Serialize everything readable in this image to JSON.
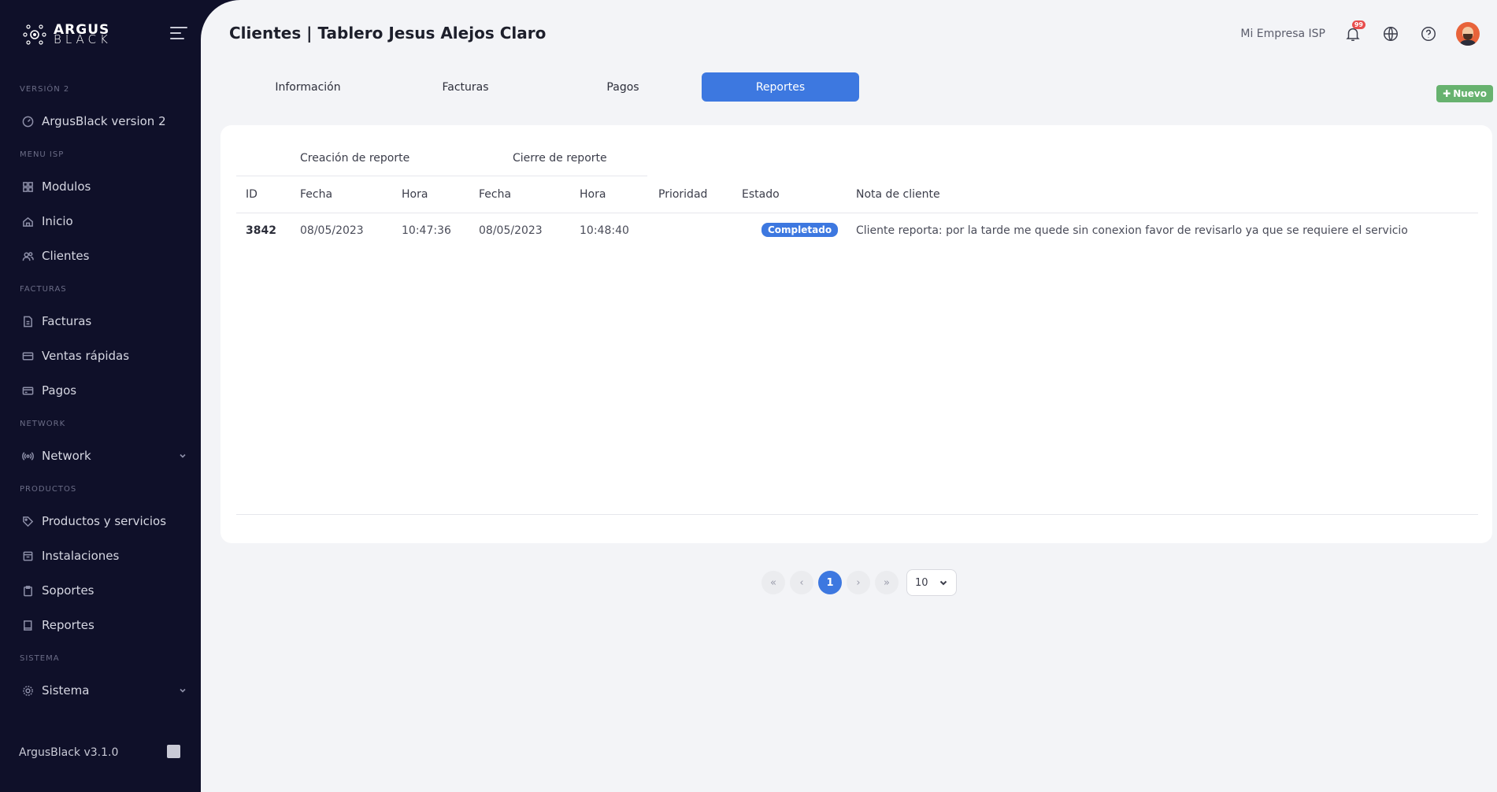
{
  "sidebar": {
    "logo_top": "ARGUS",
    "logo_bottom": "BLACK",
    "sections": {
      "version": "VERSIÓN 2",
      "menu_isp": "MENU ISP",
      "facturas": "FACTURAS",
      "network": "NETWORK",
      "productos": "PRODUCTOS",
      "sistema": "SISTEMA"
    },
    "items": {
      "argus_v2": "ArgusBlack version 2",
      "modulos": "Modulos",
      "inicio": "Inicio",
      "clientes": "Clientes",
      "facturas": "Facturas",
      "ventas": "Ventas rápidas",
      "pagos": "Pagos",
      "network": "Network",
      "productos": "Productos y servicios",
      "instalaciones": "Instalaciones",
      "soportes": "Soportes",
      "reportes": "Reportes",
      "sistema": "Sistema"
    },
    "footer_version": "ArgusBlack v3.1.0"
  },
  "header": {
    "title": "Clientes | Tablero Jesus Alejos Claro",
    "company": "Mi Empresa ISP",
    "notification_count": "99"
  },
  "tabs": [
    "Información",
    "Facturas",
    "Pagos",
    "Reportes"
  ],
  "new_button": "Nuevo",
  "table": {
    "group_creation": "Creación de reporte",
    "group_close": "Cierre de reporte",
    "columns": [
      "ID",
      "Fecha",
      "Hora",
      "Fecha",
      "Hora",
      "Prioridad",
      "Estado",
      "Nota de cliente"
    ],
    "rows": [
      {
        "id": "3842",
        "created_date": "08/05/2023",
        "created_time": "10:47:36",
        "closed_date": "08/05/2023",
        "closed_time": "10:48:40",
        "priority": "",
        "status": "Completado",
        "note": "Cliente reporta: por la tarde me quede sin conexion favor de revisarlo ya que se requiere el servicio"
      }
    ]
  },
  "pagination": {
    "first": "«",
    "prev": "‹",
    "current": "1",
    "next": "›",
    "last": "»",
    "page_size": "10"
  },
  "colors": {
    "sidebar_bg": "#0f1029",
    "accent": "#3d78e0",
    "success": "#67b26f"
  }
}
